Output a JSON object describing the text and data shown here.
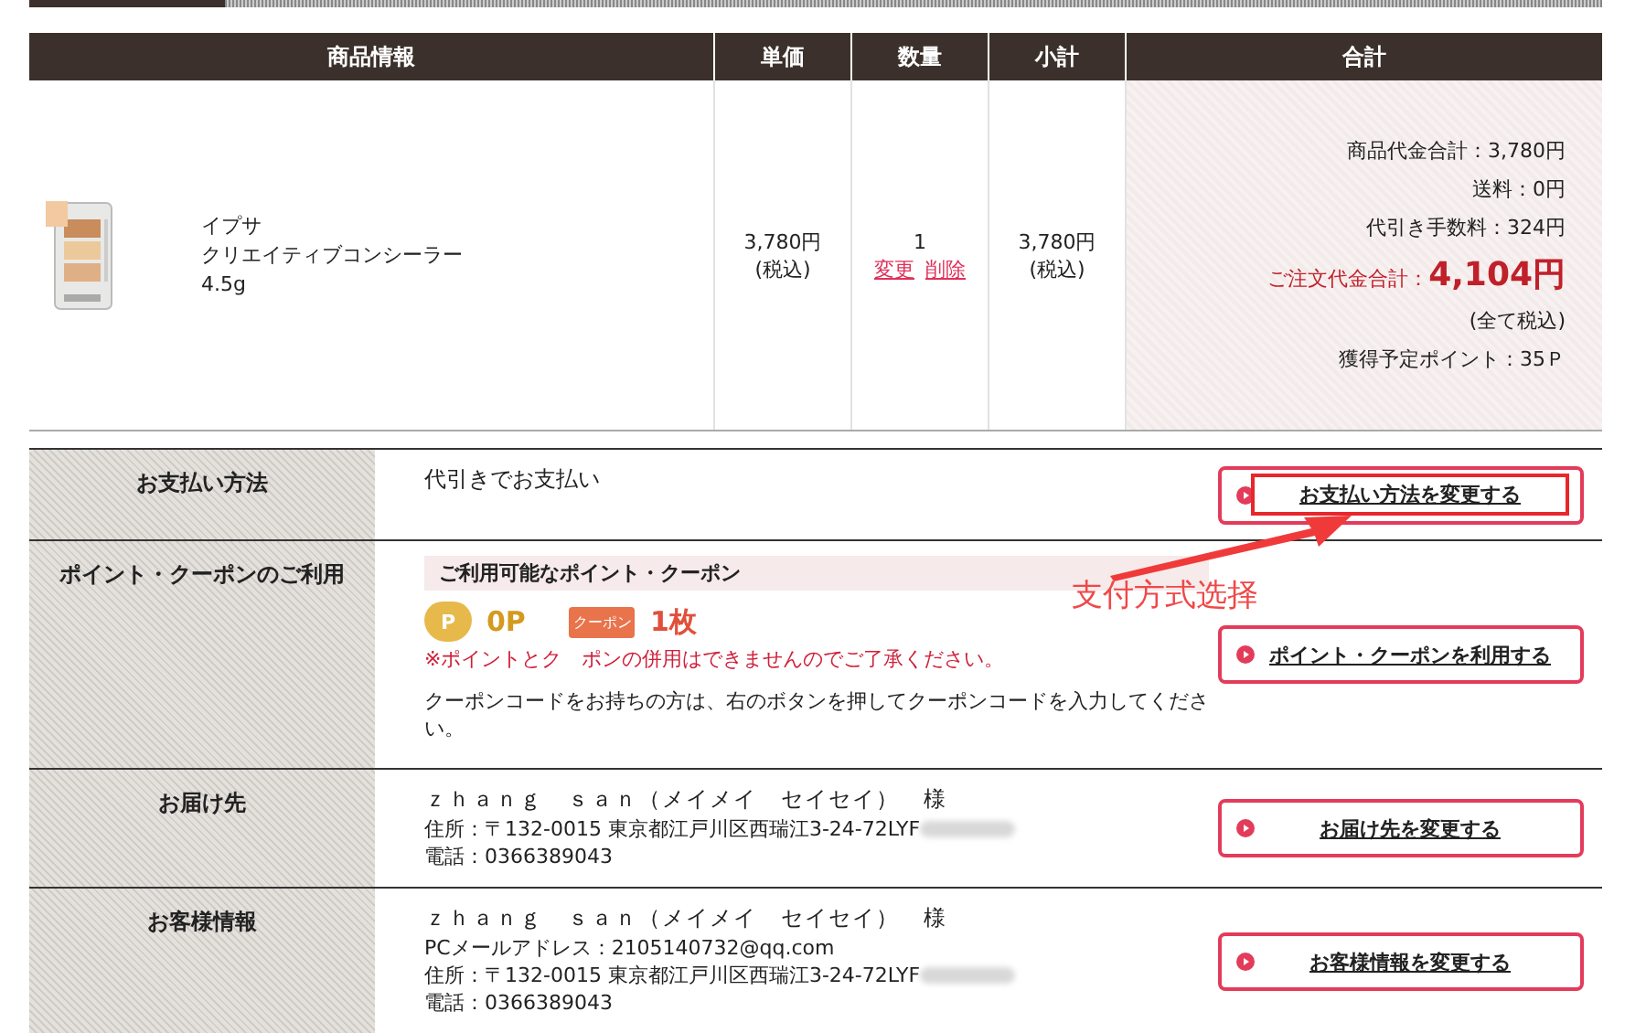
{
  "table": {
    "columns": [
      "商品情報",
      "単価",
      "数量",
      "小計",
      "合計"
    ],
    "item": {
      "picture": {
        "kind": "picture"
      },
      "name_lines": [
        "イプサ",
        "クリエイティブコンシーラー",
        "4.5g"
      ],
      "unit_price": "3,780円",
      "unit_tax": "(税込)",
      "quantity": "1",
      "actions": [
        "変更",
        "削除"
      ],
      "subtotal": "3,780円",
      "subtotal_tax": "(税込)"
    },
    "totals": [
      {
        "kind": "line",
        "text": "商品代金合計：3,780円"
      },
      {
        "kind": "line",
        "text": "送料：0円"
      },
      {
        "kind": "line",
        "text": "代引き手数料：324円"
      },
      {
        "kind": "grand",
        "label": "ご注文代金合計：",
        "amount": "4,104円"
      },
      {
        "kind": "line",
        "text": "(全て税込)"
      },
      {
        "kind": "line",
        "text": "獲得予定ポイント：35Ｐ"
      }
    ]
  },
  "sections": [
    {
      "kind": "text",
      "label": "お支払い方法",
      "text": "代引きでお支払い",
      "button": "お支払い方法を変更する",
      "highlighted": true
    },
    {
      "kind": "points",
      "label": "ポイント・クーポンのご利用",
      "heading": "ご利用可能なポイント・クーポン",
      "point_icon_label": "P",
      "points": "0P",
      "coupon_icon_label": "クーポン",
      "coupons": "1枚",
      "notice": "※ポイントとク　ポンの併用はできませんのでご了承ください。",
      "info": "クーポンコードをお持ちの方は、右のボタンを押してクーポンコードを入力してください。",
      "button": "ポイント・クーポンを利用する",
      "highlighted": false
    },
    {
      "kind": "contact",
      "label": "お届け先",
      "name": "ｚｈａｎｇ　ｓａｎ（メイメイ　セイセイ）　様",
      "lines": [
        {
          "text": "住所：〒132-0015 東京都江戸川区西瑞江3-24-72LYF",
          "redacted": true
        },
        {
          "text": "電話：0366389043",
          "redacted": false
        }
      ],
      "button": "お届け先を変更する",
      "highlighted": false
    },
    {
      "kind": "contact",
      "label": "お客様情報",
      "name": "ｚｈａｎｇ　ｓａｎ（メイメイ　セイセイ）　様",
      "lines": [
        {
          "text": "PCメールアドレス：2105140732@qq.com",
          "redacted": false
        },
        {
          "text": "住所：〒132-0015 東京都江戸川区西瑞江3-24-72LYF",
          "redacted": true
        },
        {
          "text": "電話：0366389043",
          "redacted": false
        }
      ],
      "button": "お客様情報を変更する",
      "highlighted": false
    }
  ],
  "annotation": {
    "text": "支付方式选择"
  }
}
